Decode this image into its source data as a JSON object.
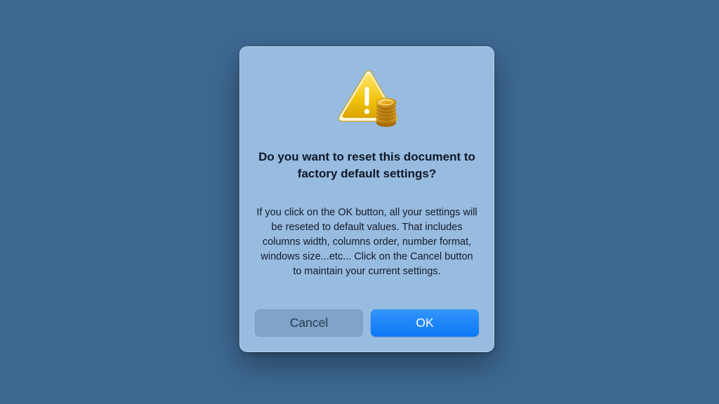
{
  "dialog": {
    "icon": "warning-triangle-with-coins-icon",
    "title": "Do you want to reset this document to factory default settings?",
    "message": "If you click on the OK button, all your settings will be reseted to default values. That includes columns width, columns order, number format, windows size...etc... Click on the Cancel button to maintain your current settings.",
    "buttons": {
      "cancel_label": "Cancel",
      "ok_label": "OK"
    }
  },
  "colors": {
    "background": "#3d6891",
    "dialog": "#98bbe0",
    "ok_button": "#0a78f6",
    "cancel_button": "#7fa3c9",
    "warning": "#f2c40e"
  }
}
